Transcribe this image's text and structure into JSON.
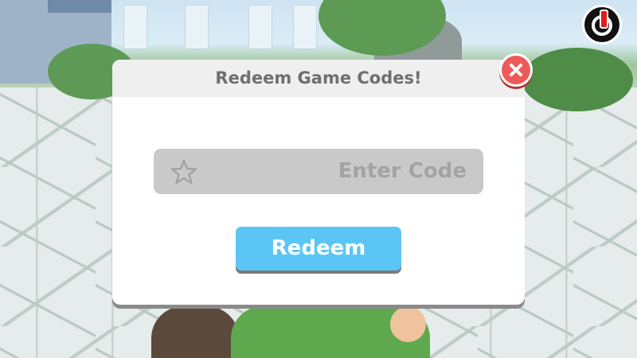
{
  "modal": {
    "title": "Redeem Game Codes!",
    "input": {
      "placeholder": "Enter Code",
      "value": "",
      "icon": "star-icon"
    },
    "redeem_button": {
      "label": "Redeem",
      "color": "#5bc6f5"
    },
    "close_button": {
      "icon": "close-icon",
      "color": "#ee5a5a"
    }
  },
  "hud": {
    "power_button": {
      "icon": "power-icon",
      "color": "#e11c1c"
    }
  }
}
